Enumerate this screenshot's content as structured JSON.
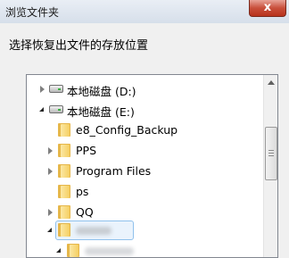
{
  "window": {
    "title": "浏览文件夹",
    "close_label": "x",
    "instruction": "选择恢复出文件的存放位置"
  },
  "tree": {
    "items": [
      {
        "label": "本地磁盘 (D:)",
        "type": "drive",
        "state": "collapsed"
      },
      {
        "label": "本地磁盘 (E:)",
        "type": "drive",
        "state": "expanded"
      },
      {
        "label": "e8_Config_Backup",
        "type": "folder",
        "state": "none"
      },
      {
        "label": "PPS",
        "type": "folder",
        "state": "collapsed"
      },
      {
        "label": "Program Files",
        "type": "folder",
        "state": "collapsed"
      },
      {
        "label": "ps",
        "type": "folder",
        "state": "none"
      },
      {
        "label": "QQ",
        "type": "folder",
        "state": "collapsed"
      },
      {
        "label": "",
        "type": "folder",
        "state": "expanded",
        "selected": true,
        "label_obscured": true
      },
      {
        "label": "",
        "type": "folder",
        "state": "expanded",
        "label_obscured": true
      }
    ]
  },
  "scrollbar": {
    "up_icon": "arrow-up-icon",
    "thumb_position_fraction": 0.3
  },
  "colors": {
    "folder": "#f5cf62",
    "selection_border": "#90c1ec",
    "close_button": "#c84f3b"
  }
}
